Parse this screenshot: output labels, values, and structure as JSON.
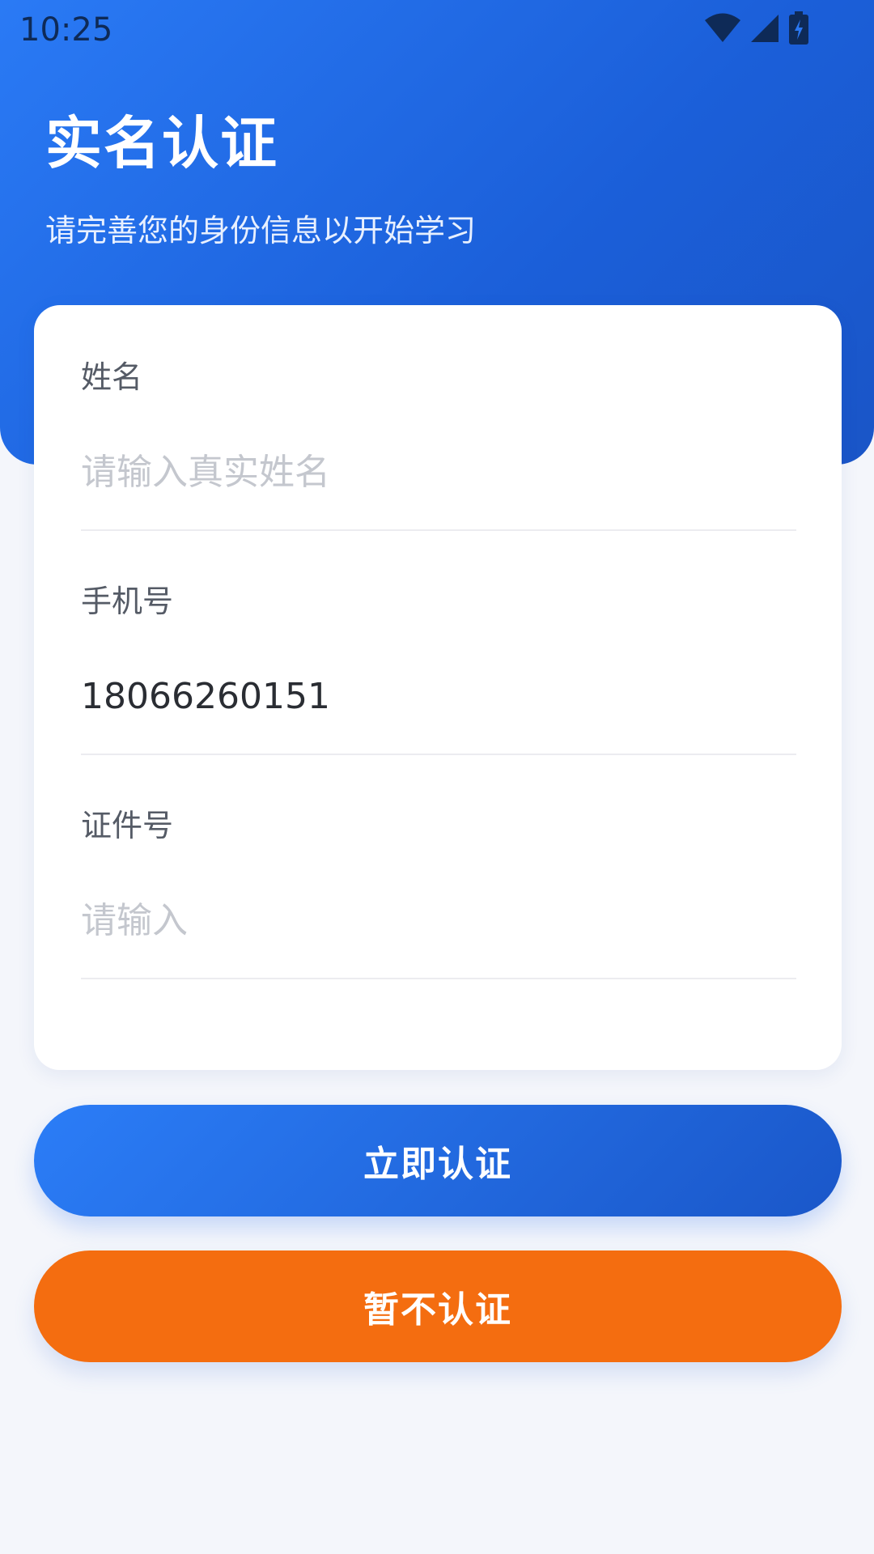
{
  "status_bar": {
    "time": "10:25",
    "icons": [
      "wifi-icon",
      "cellular-signal-icon",
      "battery-charging-icon"
    ]
  },
  "header": {
    "title": "实名认证",
    "subtitle": "请完善您的身份信息以开始学习"
  },
  "form": {
    "name": {
      "label": "姓名",
      "placeholder": "请输入真实姓名",
      "value": ""
    },
    "phone": {
      "label": "手机号",
      "placeholder": "",
      "value": "18066260151"
    },
    "id_number": {
      "label": "证件号",
      "placeholder": "请输入",
      "value": ""
    }
  },
  "actions": {
    "verify_label": "立即认证",
    "skip_label": "暂不认证"
  },
  "colors": {
    "primary_blue": "#1f6ae6",
    "accent_orange": "#f46d10",
    "background": "#f4f6fb",
    "card": "#ffffff"
  }
}
